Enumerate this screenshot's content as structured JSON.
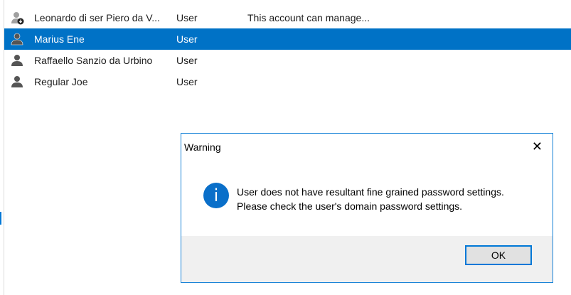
{
  "users": [
    {
      "name": "Leonardo di ser Piero da V...",
      "type": "User",
      "description": "This account can manage...",
      "icon": "user-download-icon"
    },
    {
      "name": "Marius Ene",
      "type": "User",
      "description": "",
      "selected": true,
      "icon": "user-icon"
    },
    {
      "name": "Raffaello Sanzio da Urbino",
      "type": "User",
      "description": "",
      "icon": "user-icon"
    },
    {
      "name": "Regular Joe",
      "type": "User",
      "description": "",
      "icon": "user-icon"
    }
  ],
  "dialog": {
    "title": "Warning",
    "close": "✕",
    "icon": "info-icon",
    "line1": "User does not have resultant fine grained password settings.",
    "line2": "Please check the user's domain password settings.",
    "ok": "OK"
  },
  "colors": {
    "selection": "#0072c6",
    "info": "#0a6fc9"
  }
}
